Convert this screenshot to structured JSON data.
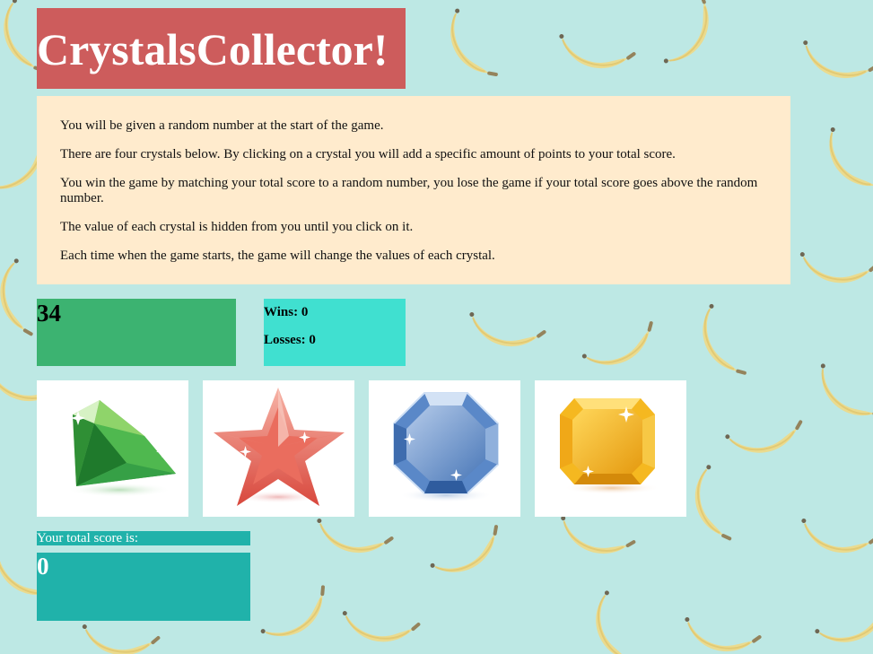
{
  "page": {
    "title": "CrystalsCollector!",
    "background_color": "#bde8e4",
    "background_pattern": "banana-pattern"
  },
  "instructions": [
    "You will be given a random number at the start of the game.",
    "There are four crystals below. By clicking on a crystal you will add a specific amount of points to your total score.",
    "You win the game by matching your total score to a random number, you lose the game if your total score goes above the random number.",
    "The value of each crystal is hidden from you until you click on it.",
    "Each time when the game starts, the game will change the values of each crystal."
  ],
  "target": {
    "value": "34"
  },
  "stats": {
    "wins": "Wins: 0",
    "losses": "Losses: 0"
  },
  "crystals": [
    {
      "icon": "green-diamond-icon"
    },
    {
      "icon": "red-star-icon"
    },
    {
      "icon": "blue-octagon-icon"
    },
    {
      "icon": "yellow-emerald-icon"
    }
  ],
  "score": {
    "label": "Your total score is:",
    "value": "0"
  },
  "colors": {
    "title_bg": "#cd5c5c",
    "instructions_bg": "#ffebcd",
    "target_bg": "#3cb371",
    "stats_bg": "#40e0d0",
    "score_bg": "#20b2aa"
  }
}
